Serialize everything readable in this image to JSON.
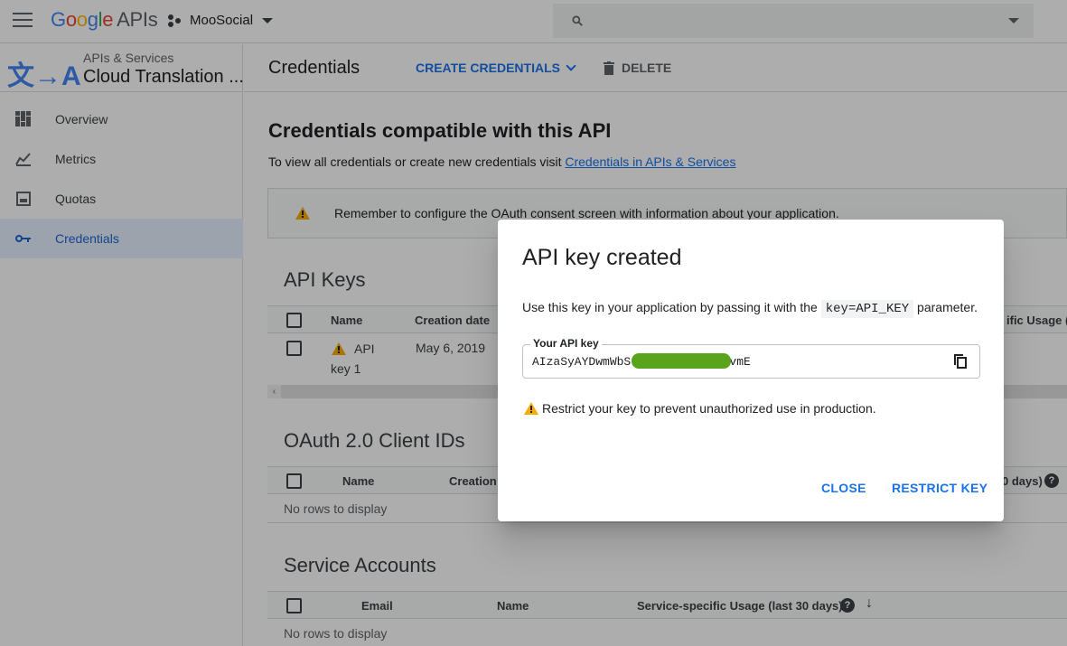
{
  "topbar": {
    "logo": [
      "G",
      "o",
      "o",
      "g",
      "l",
      "e"
    ],
    "logo_suffix": "APIs",
    "project": "MooSocial"
  },
  "sidebar": {
    "subtitle": "APIs & Services",
    "title": "Cloud Translation ...",
    "logo_text": "文→A",
    "items": [
      {
        "label": "Overview",
        "icon": "overview-icon"
      },
      {
        "label": "Metrics",
        "icon": "metrics-icon"
      },
      {
        "label": "Quotas",
        "icon": "quotas-icon"
      },
      {
        "label": "Credentials",
        "icon": "key-icon",
        "active": true
      }
    ]
  },
  "header": {
    "title": "Credentials",
    "create_label": "CREATE CREDENTIALS",
    "delete_label": "DELETE"
  },
  "main": {
    "heading": "Credentials compatible with this API",
    "intro_text": "To view all credentials or create new credentials visit ",
    "intro_link": "Credentials in APIs & Services",
    "banner_text": "Remember to configure the OAuth consent screen with information about your application.",
    "api_keys": {
      "title": "API Keys",
      "columns": [
        "Name",
        "Creation date",
        "ific Usage (la"
      ],
      "rows": [
        {
          "name_line1": "API",
          "name_line2": "key 1",
          "date": "May 6, 2019"
        }
      ]
    },
    "oauth": {
      "title": "OAuth 2.0 Client IDs",
      "columns": [
        "Name",
        "Creation",
        "0 days)"
      ],
      "empty": "No rows to display"
    },
    "service_accounts": {
      "title": "Service Accounts",
      "columns": [
        "Email",
        "Name",
        "Service-specific Usage (last 30 days)"
      ],
      "empty": "No rows to display"
    }
  },
  "dialog": {
    "title": "API key created",
    "desc_before": "Use this key in your application by passing it with the ",
    "desc_code": "key=API_KEY",
    "desc_after": " parameter.",
    "key_label": "Your API key",
    "key_value": "AIzaSyAYDwmWbS                QJ25QXvXwCnxPvmE",
    "warning": "Restrict your key to prevent unauthorized use in production.",
    "close_label": "CLOSE",
    "restrict_label": "RESTRICT KEY"
  },
  "colors": {
    "accent": "#1a73e8",
    "warning": "#f9ab00",
    "redaction": "#5aa41c"
  }
}
